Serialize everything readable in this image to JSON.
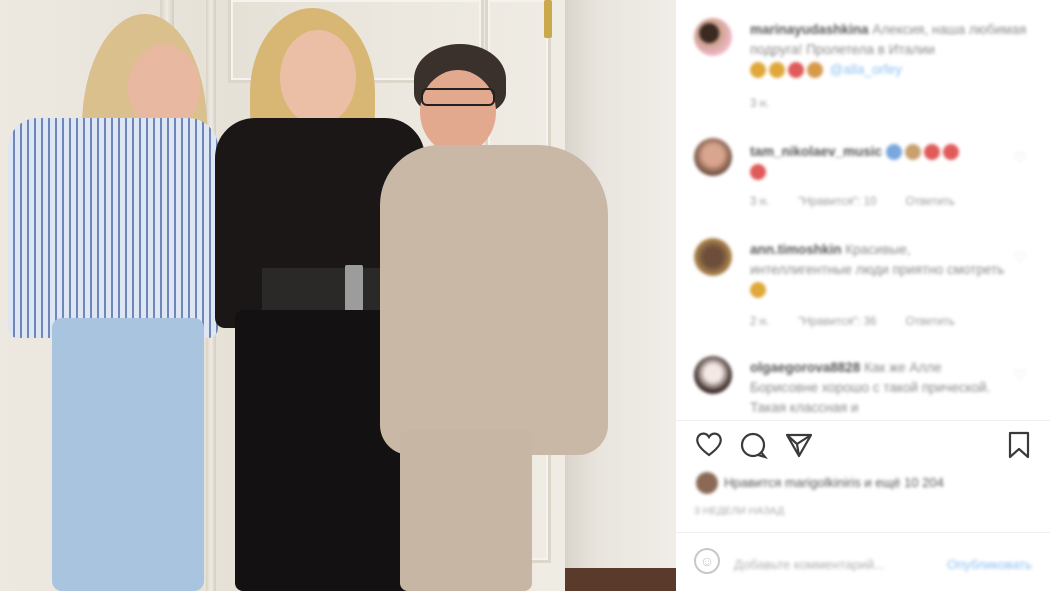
{
  "post": {
    "caption_user": "marinayudashkina",
    "caption_text": "Алексия, наша любимая подруга! Пролетела в Италии",
    "caption_mention": "@alla_orfey",
    "caption_time": "3 н."
  },
  "comments": [
    {
      "user": "tam_nikolaev_music",
      "text": "",
      "time": "3 н.",
      "likes": "\"Нравится\": 10",
      "reply": "Ответить"
    },
    {
      "user": "ann.timoshkin",
      "text": "Красивые, интеллигентные люди приятно смотреть",
      "time": "2 н.",
      "likes": "\"Нравится\": 36",
      "reply": "Ответить"
    },
    {
      "user": "olgaegorova8828",
      "text": "Как же Алле Борисовне хорошо с такой прической. Такая классная и",
      "time": "",
      "likes": "",
      "reply": ""
    }
  ],
  "actions": {
    "like_icon": "heart-icon",
    "comment_icon": "comment-icon",
    "share_icon": "share-icon",
    "save_icon": "bookmark-icon"
  },
  "likes_text": "Нравится marigolkiniris и ещё 10 204",
  "date_text": "3 НЕДЕЛИ НАЗАД",
  "add_comment": {
    "placeholder": "Добавьте комментарий...",
    "publish": "Опубликовать"
  },
  "colors": {
    "publish": "#8ec1f0",
    "heart_emoji": "#e05a5a",
    "gold_emoji": "#e0a83a"
  }
}
